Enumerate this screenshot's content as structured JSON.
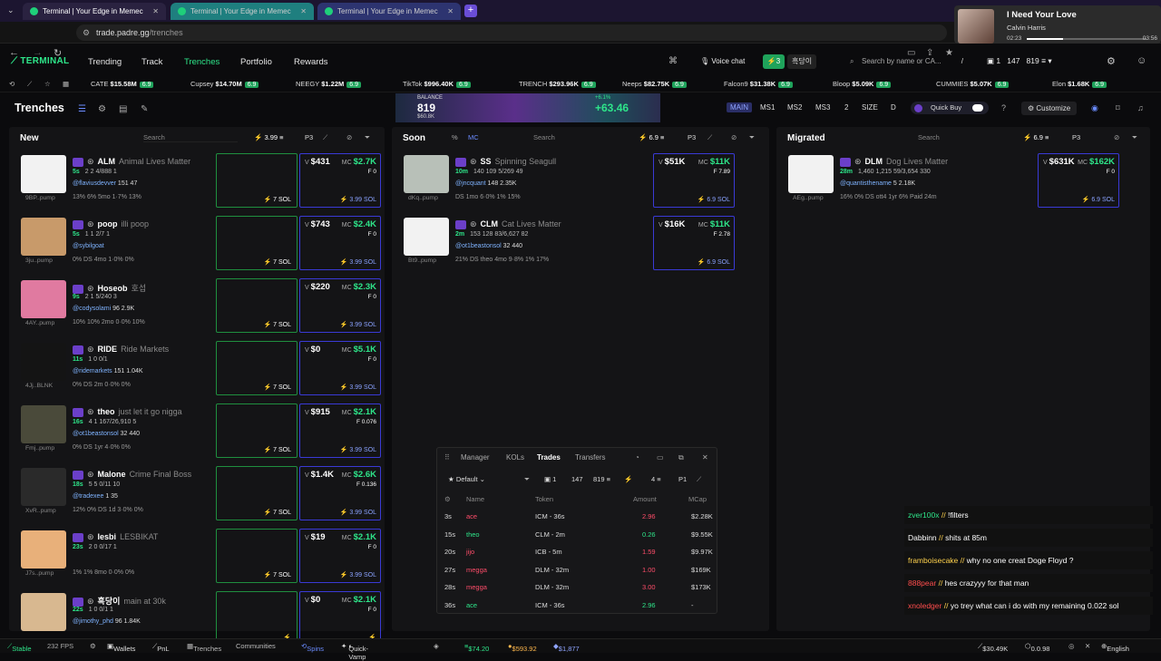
{
  "browser": {
    "tabs": [
      {
        "title": "Terminal | Your Edge in Memec"
      },
      {
        "title": "Terminal | Your Edge in Memec"
      },
      {
        "title": "Terminal | Your Edge in Memec"
      }
    ],
    "url_domain": "trade.padre.gg",
    "url_path": "/trenches"
  },
  "media": {
    "title": "I Need Your Love",
    "artist": "Calvin Harris",
    "elapsed": "02:23",
    "total": "03:56",
    "progress": 0.3
  },
  "nav": {
    "logo": "TERMINAL",
    "links": [
      "Trending",
      "Track",
      "Trenches",
      "Portfolio",
      "Rewards"
    ],
    "voice_chat": "Voice chat",
    "badge_count": "3",
    "korean_label": "흑당이",
    "search_placeholder": "Search by name or CA...",
    "search_key": "/",
    "wallet_count": "1",
    "stat_a": "147",
    "stat_b": "819"
  },
  "ticker": [
    {
      "name": "CATE",
      "value": "$15.58M",
      "change": "6.9"
    },
    {
      "name": "Cupsey",
      "value": "$14.70M",
      "change": "6.9"
    },
    {
      "name": "NEEGY",
      "value": "$1.22M",
      "change": "6.9"
    },
    {
      "name": "TikTok",
      "value": "$996.40K",
      "change": "6.9"
    },
    {
      "name": "TRENCH",
      "value": "$293.96K",
      "change": "6.9"
    },
    {
      "name": "Neeps",
      "value": "$82.75K",
      "change": "6.9"
    },
    {
      "name": "Falcon9",
      "value": "$31.38K",
      "change": "6.9"
    },
    {
      "name": "Bloop",
      "value": "$5.09K",
      "change": "6.9"
    },
    {
      "name": "CUMMIES",
      "value": "$5.07K",
      "change": "6.9"
    },
    {
      "name": "Elon",
      "value": "$1.68K",
      "change": "6.9"
    }
  ],
  "toolbar": {
    "title": "Trenches",
    "balance_label": "BALANCE",
    "balance": "819",
    "balance_sub": "$60.8K",
    "pnl": "+63.46",
    "pnl_pct": "+6.1%",
    "presets": [
      "MAIN",
      "MS1",
      "MS2",
      "MS3"
    ],
    "preset_count": "2",
    "size_label": "SIZE",
    "size_value": "D",
    "quick_buy": "Quick Buy",
    "customize": "Customize"
  },
  "columns": {
    "new": {
      "title": "New",
      "search": "Search",
      "amount": "3.99",
      "preset": "P3"
    },
    "soon": {
      "title": "Soon",
      "pct": "%",
      "mc": "MC",
      "search": "Search",
      "amount": "6.9",
      "preset": "P3"
    },
    "migrated": {
      "title": "Migrated",
      "search": "Search",
      "amount": "6.9",
      "preset": "P3"
    }
  },
  "new_tokens": [
    {
      "sym": "ALM",
      "name": "Animal Lives Matter",
      "age": "5s",
      "stats": "2  2  4/888  1",
      "handle": "@flaviusdevver",
      "followers": "151  47",
      "line4": "13%  6%  5mo  1·7%  13%",
      "addr": "9BP..pump",
      "v": "$431",
      "mc": "$2.7K",
      "f": "0",
      "sol7": "7 SOL",
      "sol": "3.99 SOL",
      "avatar": "#f2f2f2"
    },
    {
      "sym": "poop",
      "name": "illi poop",
      "age": "5s",
      "stats": "1  1  2/7  1",
      "handle": "@sybilgoat",
      "followers": "",
      "line4": "0%  DS  4mo  1·0%  0%",
      "addr": "3ju..pump",
      "v": "$743",
      "mc": "$2.4K",
      "f": "0",
      "sol7": "7 SOL",
      "sol": "3.99 SOL",
      "avatar": "#c89a6a"
    },
    {
      "sym": "Hoseob",
      "name": "호섭",
      "age": "9s",
      "stats": "2  1  5/240  3",
      "handle": "@codysolami",
      "followers": "96  2.9K",
      "line4": "10%  10%  2mo  0·0%  10%",
      "addr": "4AY..pump",
      "v": "$220",
      "mc": "$2.3K",
      "f": "0",
      "sol7": "7 SOL",
      "sol": "3.99 SOL",
      "avatar": "#e07aa0"
    },
    {
      "sym": "RIDE",
      "name": "Ride Markets",
      "age": "11s",
      "stats": "1  0  0/1",
      "handle": "@ridemarkets",
      "followers": "151  1.04K",
      "line4": "0%  DS  2m  0·0%  0%",
      "addr": "4Jj..BLNK",
      "v": "$0",
      "mc": "$5.1K",
      "f": "0",
      "sol7": "7 SOL",
      "sol": "3.99 SOL",
      "avatar": "#141414"
    },
    {
      "sym": "theo",
      "name": "just let it go nigga",
      "age": "16s",
      "stats": "4  1  167/26,910  5",
      "handle": "@ot1beastonsol",
      "followers": "32  440",
      "line4": "0%  DS  1yr  4·0%  0%",
      "addr": "Fmj..pump",
      "v": "$915",
      "mc": "$2.1K",
      "f": "0.076",
      "sol7": "7 SOL",
      "sol": "3.99 SOL",
      "avatar": "#4a4a3a"
    },
    {
      "sym": "Malone",
      "name": "Crime Final Boss",
      "age": "18s",
      "stats": "5  5  0/11  10",
      "handle": "@tradexee",
      "followers": "1  35",
      "line4": "12%  0%  DS  1d  3·0%  0%",
      "addr": "XvR..pump",
      "v": "$1.4K",
      "mc": "$2.6K",
      "f": "0.136",
      "sol7": "7 SOL",
      "sol": "3.99 SOL",
      "avatar": "#2a2a2a"
    },
    {
      "sym": "lesbi",
      "name": "LESBIKAT",
      "age": "23s",
      "stats": "2  0  0/17  1",
      "handle": "",
      "followers": "",
      "line4": "1%  1%  8mo  0·0%  0%",
      "addr": "J7s..pump",
      "v": "$19",
      "mc": "$2.1K",
      "f": "0",
      "sol7": "7 SOL",
      "sol": "3.99 SOL",
      "avatar": "#e8b07a"
    },
    {
      "sym": "흑당이",
      "name": "main at 30k",
      "age": "22s",
      "stats": "1  0  0/1  1",
      "handle": "@jimothy_phd",
      "followers": "96  1.84K",
      "line4": "",
      "addr": "",
      "v": "$0",
      "mc": "$2.1K",
      "f": "0",
      "sol7": "",
      "sol": "",
      "avatar": "#d8b890"
    }
  ],
  "soon_tokens": [
    {
      "sym": "SS",
      "name": "Spinning Seagull",
      "age": "10m",
      "stats": "140  109  5/269  49",
      "handle": "@jncquant",
      "followers": "148  2.35K",
      "line4": "DS  1mo  6·0%  1%  15%",
      "addr": "dKq..pump",
      "v": "$51K",
      "mc": "$11K",
      "f": "7.89",
      "sol": "6.9 SOL",
      "avatar": "#b8c0b8"
    },
    {
      "sym": "CLM",
      "name": "Cat Lives Matter",
      "age": "2m",
      "stats": "153  128  83/6,627  82",
      "handle": "@ot1beastonsol",
      "followers": "32  440",
      "line4": "21%  DS  theo  4mo  9·8%  1%  17%",
      "addr": "Bt9..pump",
      "v": "$16K",
      "mc": "$11K",
      "f": "2.78",
      "sol": "6.9 SOL",
      "avatar": "#f2f2f2"
    }
  ],
  "migrated_tokens": [
    {
      "sym": "DLM",
      "name": "Dog Lives Matter",
      "age": "28m",
      "stats": "1,460  1,215  59/3,654  330",
      "handle": "@quantisthename",
      "followers": "5  2.18K",
      "line4": "16%  0%  DS  ott4  1yr  6%  Paid  24m",
      "addr": "AEg..pump",
      "v": "$631K",
      "mc": "$162K",
      "f": "0",
      "sol": "6.9 SOL",
      "avatar": "#f2f2f2"
    }
  ],
  "trades_widget": {
    "tabs": [
      "Manager",
      "KOLs",
      "Trades",
      "Transfers"
    ],
    "active_tab": "Trades",
    "preset": "Default",
    "sub_stats": [
      "1",
      "147",
      "819",
      "4",
      "P1"
    ],
    "headers": [
      "Name",
      "Token",
      "Amount",
      "MCap"
    ],
    "rows": [
      {
        "time": "3s",
        "name": "ace",
        "token": "ICM - 36s",
        "amount": "2.96",
        "mcap": "$2.28K",
        "side": "sell"
      },
      {
        "time": "15s",
        "name": "theo",
        "token": "CLM - 2m",
        "amount": "0.26",
        "mcap": "$9.55K",
        "side": "buy"
      },
      {
        "time": "20s",
        "name": "jijo",
        "token": "ICB - 5m",
        "amount": "1.59",
        "mcap": "$9.97K",
        "side": "sell"
      },
      {
        "time": "27s",
        "name": "megga",
        "token": "DLM - 32m",
        "amount": "1.00",
        "mcap": "$169K",
        "side": "sell"
      },
      {
        "time": "28s",
        "name": "megga",
        "token": "DLM - 32m",
        "amount": "3.00",
        "mcap": "$173K",
        "side": "sell"
      },
      {
        "time": "36s",
        "name": "ace",
        "token": "ICM - 36s",
        "amount": "2.96",
        "mcap": "-",
        "side": "buy"
      }
    ]
  },
  "chat": [
    {
      "user": "zver100x",
      "msg": "!filters",
      "color": "#2ee68a"
    },
    {
      "user": "Dabbinn",
      "msg": "shits at 85m",
      "color": "#ffffff"
    },
    {
      "user": "framboisecake",
      "msg": "why no one creat Doge Floyd ?",
      "color": "#ffd24d"
    },
    {
      "user": "888pear",
      "msg": "hes crazyyy for that man",
      "color": "#ff4d4d"
    },
    {
      "user": "xnoledger",
      "msg": "yo trey what can i do with my remaining 0.022 sol",
      "color": "#ff4d4d"
    }
  ],
  "status": {
    "stable": "Stable",
    "fps": "232 FPS",
    "wallets": "Wallets",
    "pnl": "PnL",
    "trenches": "Trenches",
    "communities": "Communities",
    "spins": "Spins",
    "quick_vamp": "Quick-Vamp",
    "sol_price": "$74.20",
    "btc_price": "$593.92",
    "eth_price": "$1,877",
    "volume": "$30.49K",
    "fees": "0.0.98",
    "language": "English"
  }
}
